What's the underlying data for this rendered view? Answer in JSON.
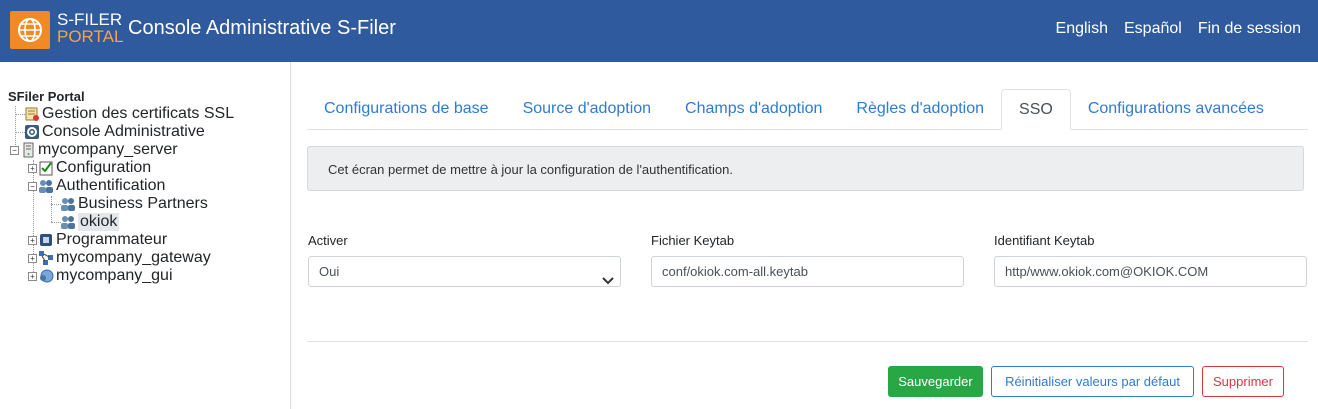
{
  "header": {
    "logo_line1": "S-FILER",
    "logo_line2": "PORTAL",
    "title": "Console Administrative S-Filer",
    "links": [
      "English",
      "Español",
      "Fin de session"
    ]
  },
  "sidebar": {
    "root": "SFiler Portal",
    "nodes": [
      {
        "label": "Gestion des certificats SSL",
        "icon": "certificate-icon"
      },
      {
        "label": "Console Administrative",
        "icon": "gear-icon"
      },
      {
        "label": "mycompany_server",
        "icon": "server-icon",
        "expanded": true
      },
      {
        "label": "Configuration",
        "icon": "checklist-icon",
        "expanded": false
      },
      {
        "label": "Authentification",
        "icon": "users-icon",
        "expanded": true
      },
      {
        "label": "Business Partners",
        "icon": "users-icon"
      },
      {
        "label": "okiok",
        "icon": "users-icon",
        "selected": true
      },
      {
        "label": "Programmateur",
        "icon": "scheduler-icon",
        "expanded": false
      },
      {
        "label": "mycompany_gateway",
        "icon": "network-icon",
        "expanded": false
      },
      {
        "label": "mycompany_gui",
        "icon": "globe-user-icon",
        "expanded": false
      }
    ]
  },
  "tabs": [
    {
      "label": "Configurations de base"
    },
    {
      "label": "Source d'adoption"
    },
    {
      "label": "Champs d'adoption"
    },
    {
      "label": "Règles d'adoption"
    },
    {
      "label": "SSO",
      "active": true
    },
    {
      "label": "Configurations avancées"
    }
  ],
  "info_text": "Cet écran permet de mettre à jour la configuration de l'authentification.",
  "form": {
    "activer_label": "Activer",
    "activer_value": "Oui",
    "keytab_file_label": "Fichier Keytab",
    "keytab_file_value": "conf/okiok.com-all.keytab",
    "keytab_id_label": "Identifiant Keytab",
    "keytab_id_value": "http/www.okiok.com@OKIOK.COM"
  },
  "buttons": {
    "save": "Sauvegarder",
    "reset": "Réinitialiser valeurs par défaut",
    "delete": "Supprimer"
  },
  "colors": {
    "header_bg": "#2f5a9e",
    "logo_bg": "#f08a24",
    "link": "#2f7bd3",
    "save": "#28a745",
    "delete": "#dc3545"
  }
}
